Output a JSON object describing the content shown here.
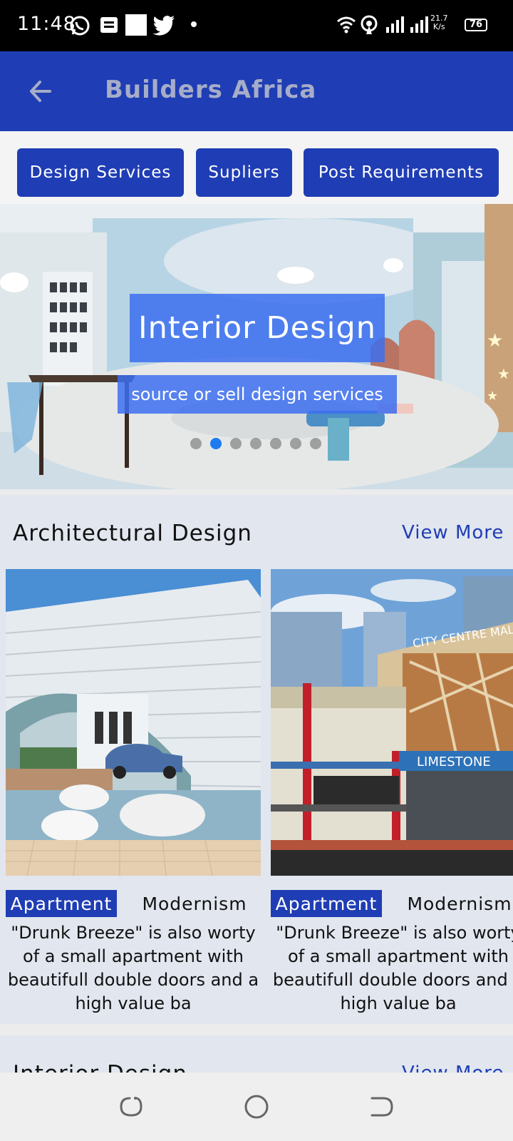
{
  "status_bar": {
    "time": "11:48",
    "net_speed_value": "21.7",
    "net_speed_unit": "K/s",
    "battery": "76"
  },
  "app_bar": {
    "title": "Builders Africa",
    "back_icon": "arrow-left-icon"
  },
  "chips": [
    {
      "label": "Design Services"
    },
    {
      "label": "Supliers"
    },
    {
      "label": "Post Requirements"
    }
  ],
  "banner": {
    "title": "Interior Design",
    "subtitle": "source or sell design services",
    "slide_count": 7,
    "active_slide": 2
  },
  "section": {
    "title": "Architectural Design",
    "view_more": "View More",
    "cards": [
      {
        "tag_primary": "Apartment",
        "tag_secondary": "Modernism",
        "description": "\"Drunk Breeze\" is also worty of a small apartment with beautifull double doors and a high value ba"
      },
      {
        "tag_primary": "Apartment",
        "tag_secondary": "Modernism",
        "description": "\"Drunk Breeze\" is also worty of a small apartment with beautifull double doors and a high value ba"
      }
    ]
  },
  "section2": {
    "title": "Interior Design",
    "view_more": "View More"
  },
  "colors": {
    "primary": "#1f3db4",
    "banner_overlay": "#3c6ef0",
    "active_dot": "#1e7bf0",
    "section_bg": "#e1e6ef"
  }
}
